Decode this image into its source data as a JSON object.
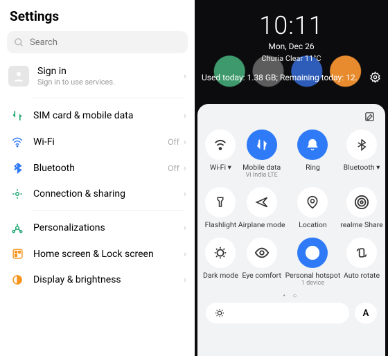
{
  "left": {
    "title": "Settings",
    "search_placeholder": "Search",
    "signin": {
      "title": "Sign in",
      "subtitle": "Sign in to use services."
    },
    "items": {
      "sim": {
        "label": "SIM card & mobile data",
        "value": ""
      },
      "wifi": {
        "label": "Wi-Fi",
        "value": "Off"
      },
      "bt": {
        "label": "Bluetooth",
        "value": "Off"
      },
      "conn": {
        "label": "Connection & sharing",
        "value": ""
      },
      "pers": {
        "label": "Personalizations",
        "value": ""
      },
      "home": {
        "label": "Home screen & Lock screen",
        "value": ""
      },
      "disp": {
        "label": "Display & brightness",
        "value": ""
      }
    }
  },
  "right": {
    "time": "10:11",
    "date": "Mon, Dec 26",
    "weather": "Churia Clear 11°C",
    "usage": "Used today: 1.38 GB; Remaining today: 12.",
    "tiles": {
      "wifi": {
        "label": "Wi-Fi ▾",
        "sub": ""
      },
      "mdata": {
        "label": "Mobile data",
        "sub": "Vi India LTE"
      },
      "ring": {
        "label": "Ring",
        "sub": ""
      },
      "bt": {
        "label": "Bluetooth ▾",
        "sub": ""
      },
      "flash": {
        "label": "Flashlight",
        "sub": ""
      },
      "air": {
        "label": "Airplane mode",
        "sub": ""
      },
      "loc": {
        "label": "Location",
        "sub": ""
      },
      "share": {
        "label": "realme Share",
        "sub": ""
      },
      "dark": {
        "label": "Dark mode",
        "sub": ""
      },
      "eye": {
        "label": "Eye comfort",
        "sub": ""
      },
      "hot": {
        "label": "Personal hotspot",
        "sub": "1 device"
      },
      "rot": {
        "label": "Auto rotate",
        "sub": ""
      }
    },
    "auto": "A",
    "dots": "• ○"
  }
}
